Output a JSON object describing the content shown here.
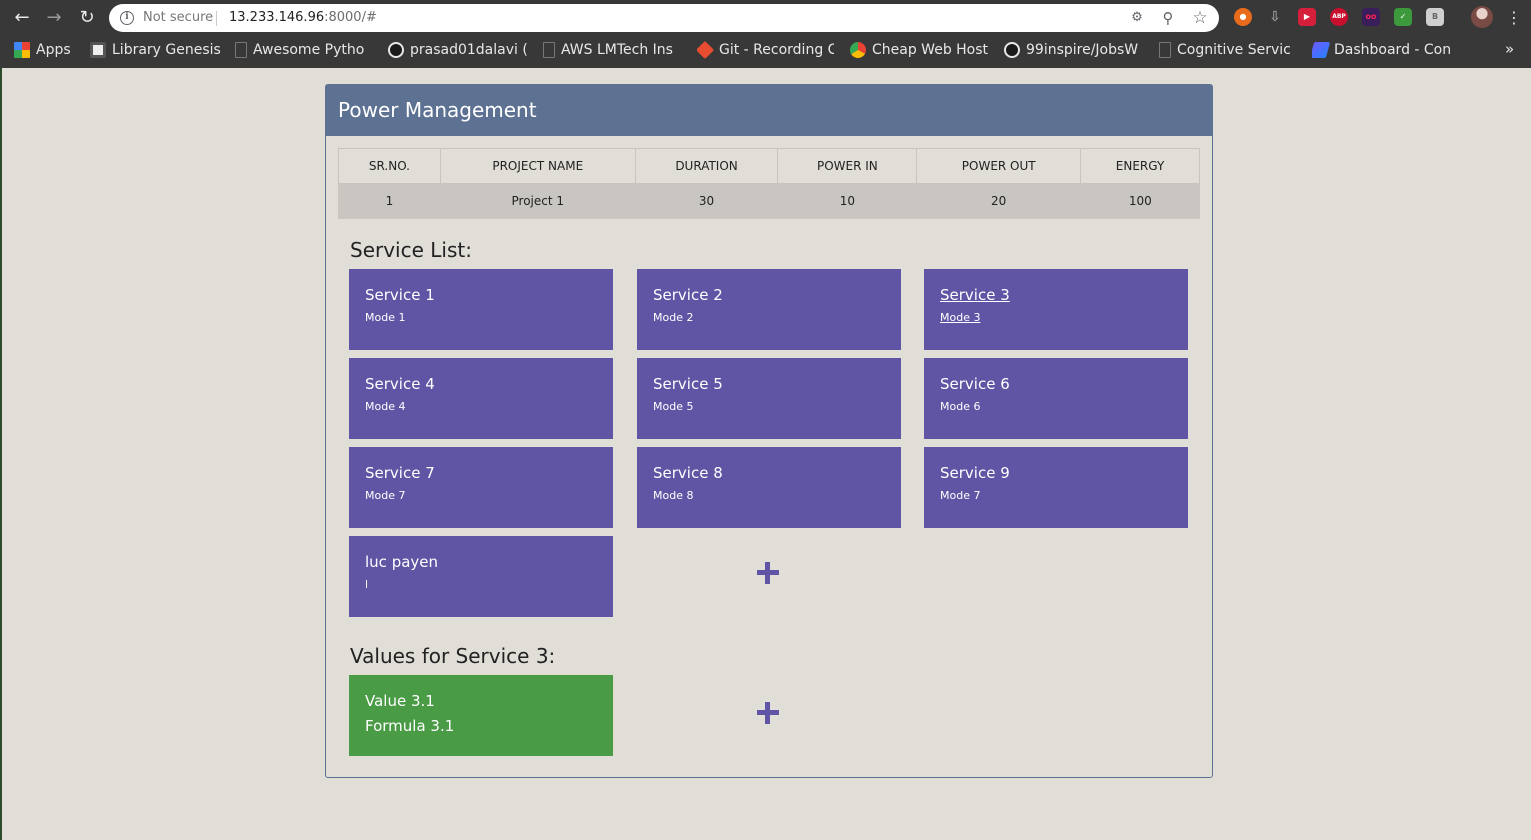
{
  "browser": {
    "security_label": "Not secure",
    "url_host": "13.233.146.96",
    "url_rest": ":8000/#",
    "bookmarks": [
      {
        "label": "Apps",
        "icon": "apps-grid-icon"
      },
      {
        "label": "Library Genesis",
        "icon": "book-icon"
      },
      {
        "label": "Awesome Pytho",
        "icon": "page-icon"
      },
      {
        "label": "prasad01dalavi (",
        "icon": "github-icon"
      },
      {
        "label": "AWS LMTech Ins",
        "icon": "page-icon"
      },
      {
        "label": "Git - Recording C",
        "icon": "git-icon"
      },
      {
        "label": "Cheap Web Host",
        "icon": "chrome-icon"
      },
      {
        "label": "99inspire/JobsW",
        "icon": "github-icon"
      },
      {
        "label": "Cognitive Servic",
        "icon": "page-icon"
      },
      {
        "label": "Dashboard - Con",
        "icon": "azure-icon"
      }
    ],
    "more_bookmarks": "»"
  },
  "panel": {
    "title": "Power Management"
  },
  "table": {
    "headers": [
      "SR.NO.",
      "PROJECT NAME",
      "DURATION",
      "POWER IN",
      "POWER OUT",
      "ENERGY"
    ],
    "rows": [
      [
        "1",
        "Project 1",
        "30",
        "10",
        "20",
        "100"
      ]
    ]
  },
  "services": {
    "title": "Service List:",
    "items": [
      {
        "name": "Service 1",
        "mode": "Mode 1",
        "selected": false
      },
      {
        "name": "Service 2",
        "mode": "Mode 2",
        "selected": false
      },
      {
        "name": "Service 3",
        "mode": "Mode 3",
        "selected": true
      },
      {
        "name": "Service 4",
        "mode": "Mode 4",
        "selected": false
      },
      {
        "name": "Service 5",
        "mode": "Mode 5",
        "selected": false
      },
      {
        "name": "Service 6",
        "mode": "Mode 6",
        "selected": false
      },
      {
        "name": "Service 7",
        "mode": "Mode 7",
        "selected": false
      },
      {
        "name": "Service 8",
        "mode": "Mode 8",
        "selected": false
      },
      {
        "name": "Service 9",
        "mode": "Mode 7",
        "selected": false
      },
      {
        "name": "luc payen",
        "mode": "l",
        "selected": false
      }
    ]
  },
  "values": {
    "title": "Values for Service 3:",
    "items": [
      {
        "name": "Value 3.1",
        "formula": "Formula 3.1"
      }
    ]
  },
  "colors": {
    "service_card": "#5f55a4",
    "value_card": "#4a9b46",
    "panel_header": "#5d7193"
  }
}
